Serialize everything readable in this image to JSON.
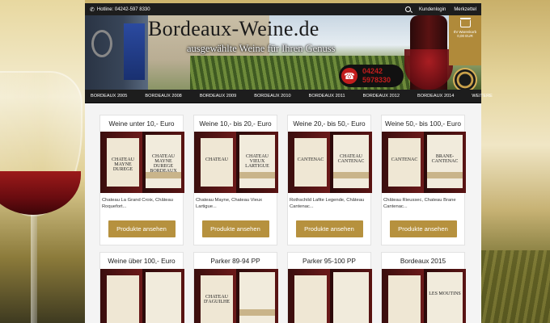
{
  "topbar": {
    "hotline": "Hotline: 04242-597 8330",
    "login": "Kundenlogin",
    "wishlist": "Merkzettel"
  },
  "banner": {
    "site_title": "Bordeaux-Weine.de",
    "tagline": "ausgewählte Weine für Ihren Genuss",
    "phone_line1": "04242",
    "phone_line2": "5978330",
    "cart_label": "Ihr Warenkorb",
    "cart_total": "0,00 EUR"
  },
  "nav": {
    "items": [
      "BORDEAUX 2005",
      "BORDEAUX 2008",
      "BORDEAUX 2009",
      "BORDEAUX 2010",
      "BORDEAUX 2011",
      "BORDEAUX 2012",
      "BORDEAUX 2014",
      "WEITERE"
    ]
  },
  "cards": [
    {
      "title": "Weine unter 10,- Euro",
      "desc": "Chateau La Grand Croix, Château Roquefort...",
      "button": "Produkte ansehen",
      "label_left": "CHATEAU MAYNE DUREGE",
      "label_right": "CHATEAU MAYNE DUREGE BORDEAUX"
    },
    {
      "title": "Weine 10,- bis 20,- Euro",
      "desc": "Chateau Mayne, Chateau Vieux Lartigue...",
      "button": "Produkte ansehen",
      "label_left": "CHATEAU",
      "label_right": "CHATEAU VIEUX LARTIGUE"
    },
    {
      "title": "Weine 20,- bis 50,- Euro",
      "desc": "Rothschild Lafite Legende, Château Cantenac...",
      "button": "Produkte ansehen",
      "label_left": "CANTENAC",
      "label_right": "CHATEAU CANTENAC"
    },
    {
      "title": "Weine 50,- bis 100,- Euro",
      "desc": "Château Rieussec, Chateau Brane Cantenac...",
      "button": "Produkte ansehen",
      "label_left": "CANTENAC",
      "label_right": "BRANE-CANTENAC"
    },
    {
      "title": "Weine über 100,- Euro",
      "desc": "",
      "button": "",
      "label_left": "",
      "label_right": ""
    },
    {
      "title": "Parker 89-94 PP",
      "desc": "",
      "button": "",
      "label_left": "CHATEAU D'AGUILHE",
      "label_right": ""
    },
    {
      "title": "Parker 95-100 PP",
      "desc": "",
      "button": "",
      "label_left": "",
      "label_right": ""
    },
    {
      "title": "Bordeaux 2015",
      "desc": "",
      "button": "",
      "label_left": "",
      "label_right": "LES MOUTINS"
    }
  ],
  "colors": {
    "accent_gold": "#b6913e",
    "bar_dark": "#1d1d1d",
    "phone_red": "#c21d1d"
  }
}
